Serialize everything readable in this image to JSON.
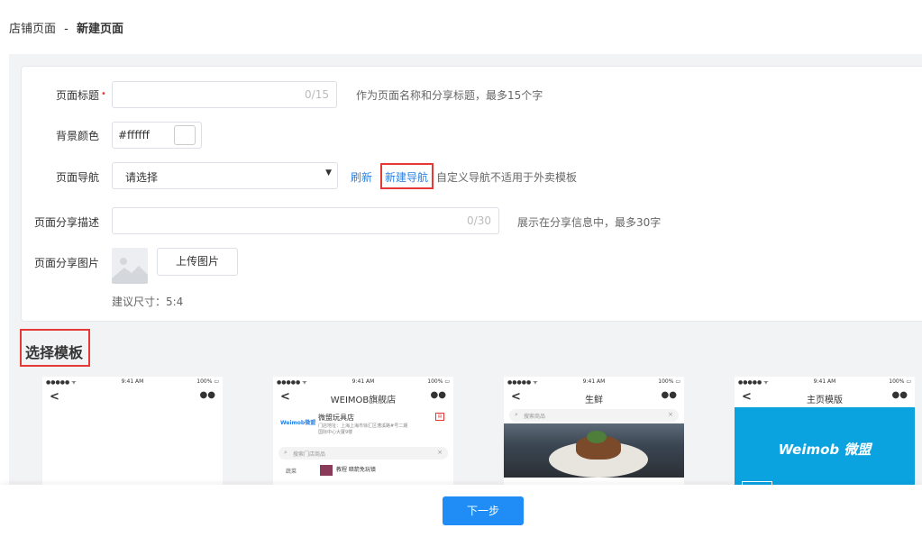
{
  "breadcrumb": {
    "parent": "店铺页面",
    "separator": "-",
    "current": "新建页面"
  },
  "form": {
    "title": {
      "label": "页面标题",
      "required_mark": "•",
      "value": "",
      "counter": "0/15",
      "hint": "作为页面名称和分享标题，最多15个字"
    },
    "bg_color": {
      "label": "背景颜色",
      "value": "#ffffff",
      "swatch": "#ffffff"
    },
    "nav": {
      "label": "页面导航",
      "placeholder": "请选择",
      "caret": "▼",
      "refresh_link": "刷新",
      "new_nav_link": "新建导航",
      "hint": "自定义导航不适用于外卖模板"
    },
    "share_desc": {
      "label": "页面分享描述",
      "value": "",
      "counter": "0/30",
      "hint": "展示在分享信息中，最多30字"
    },
    "share_img": {
      "label": "页面分享图片",
      "upload_label": "上传图片",
      "size_hint": "建议尺寸：5:4"
    }
  },
  "templates": {
    "section_title": "选择模板",
    "items": [
      {
        "status_left": "●●●●● ᯤ",
        "status_time": "9:41 AM",
        "status_right": "100% ▭",
        "back": "<",
        "title": "",
        "dots": "●●"
      },
      {
        "status_left": "●●●●● ᯤ",
        "status_time": "9:41 AM",
        "status_right": "100% ▭",
        "back": "<",
        "title": "WEIMOB旗舰店",
        "dots": "●●",
        "shop_logo": "Weimob微盟",
        "shop_name": "微盟玩具店",
        "shop_addr": "门店地址：上海上海市徐汇区漕溪路#号二期国际中心大厦9楼",
        "badge": "▤",
        "search_placeholder": "搜索门店商品",
        "search_icon": "⌕",
        "clear_icon": "×",
        "category": "蔬菜",
        "product_text": "教程 暗箭免玩镇"
      },
      {
        "status_left": "●●●●● ᯤ",
        "status_time": "9:41 AM",
        "status_right": "100% ▭",
        "back": "<",
        "title": "生鲜",
        "dots": "●●",
        "search_placeholder": "搜索商品",
        "search_icon": "⌕",
        "clear_icon": "×"
      },
      {
        "status_left": "●●●●● ᯤ",
        "status_time": "9:41 AM",
        "status_right": "100% ▭",
        "back": "<",
        "title": "主页模版",
        "dots": "●●",
        "banner_logo": "Weimob 微盟"
      }
    ]
  },
  "footer": {
    "next_label": "下一步"
  },
  "colors": {
    "accent": "#1f8df5",
    "link": "#2a82e4",
    "highlight_border": "#e53935",
    "banner": "#0aa3e0"
  }
}
